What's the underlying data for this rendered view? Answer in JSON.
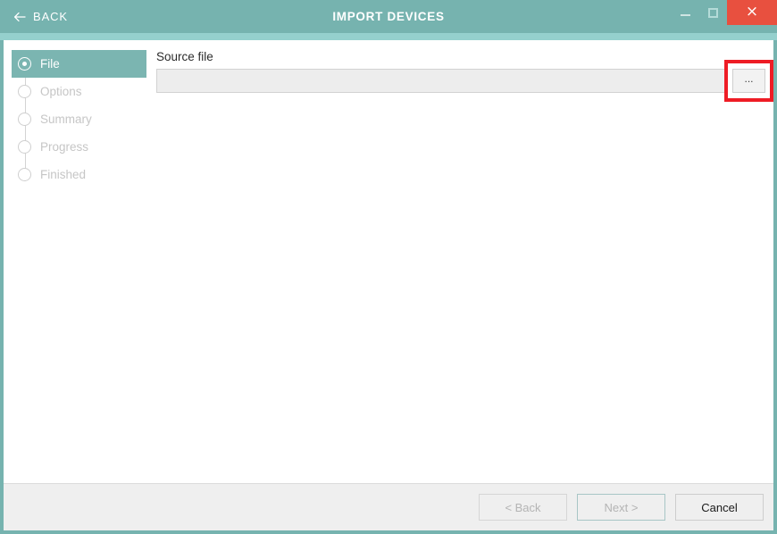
{
  "window": {
    "title": "IMPORT DEVICES",
    "back_label": "BACK",
    "back_icon": "arrow-left-icon",
    "controls": {
      "minimize": "minimize-icon",
      "maximize": "maximize-icon",
      "close": "×",
      "close_icon": "close-icon"
    },
    "accent_color": "#76b3af",
    "accent_light_color": "#95d0cd",
    "close_color": "#e8503f"
  },
  "sidebar": {
    "steps": [
      {
        "label": "File",
        "state": "active"
      },
      {
        "label": "Options",
        "state": "inactive"
      },
      {
        "label": "Summary",
        "state": "inactive"
      },
      {
        "label": "Progress",
        "state": "inactive"
      },
      {
        "label": "Finished",
        "state": "inactive"
      }
    ]
  },
  "main": {
    "source_file_label": "Source file",
    "source_file_value": "",
    "source_file_placeholder": "",
    "browse_button_label": "...",
    "highlight_color": "#ee1c25"
  },
  "footer": {
    "back_button": "< Back",
    "next_button": "Next >",
    "cancel_button": "Cancel"
  }
}
